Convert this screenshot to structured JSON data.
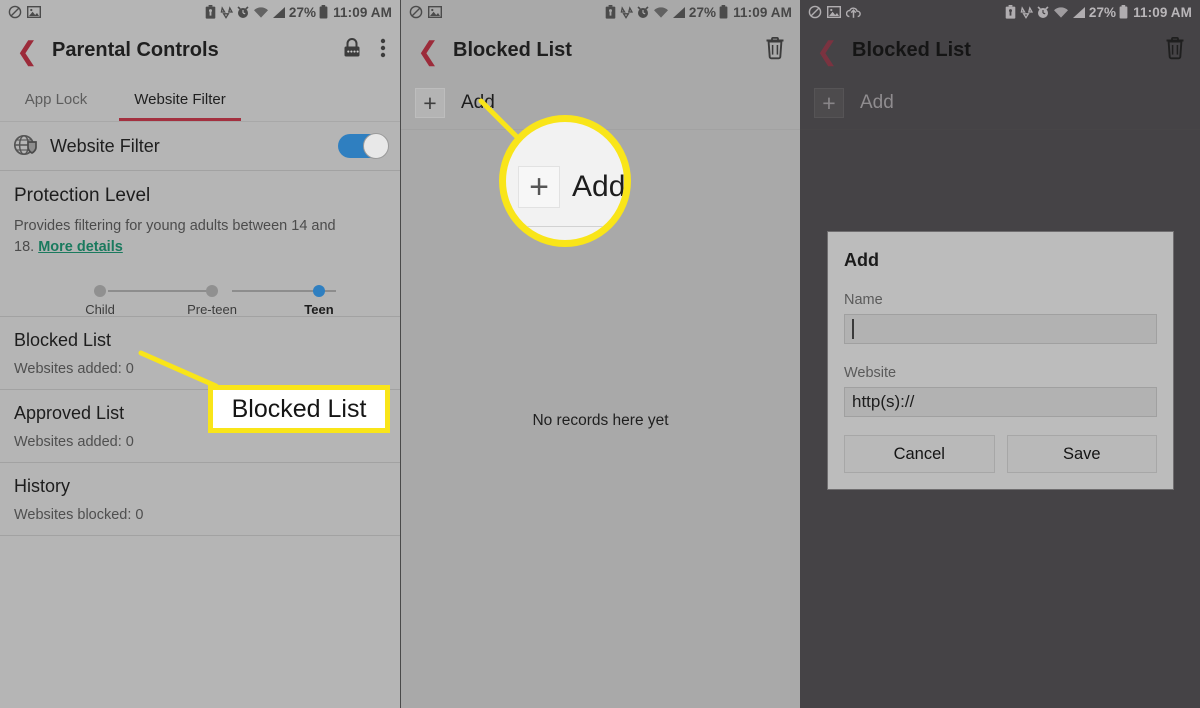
{
  "status_bar": {
    "left_icons": [
      "mute-icon",
      "screenshot-image-icon"
    ],
    "left_icons_panel3": [
      "mute-icon",
      "screenshot-image-icon",
      "upload-cloud-icon"
    ],
    "battery_percent": "27%",
    "time": "11:09 AM",
    "right_icons": [
      "battery-saver-icon",
      "data-saver-icon",
      "alarm-icon",
      "wifi-icon",
      "signal-icon",
      "battery-icon"
    ]
  },
  "panel1": {
    "title": "Parental Controls",
    "back_icon": "back-chevron-icon",
    "lock_icon": "lock-pin-icon",
    "overflow_icon": "more-vertical-icon",
    "tabs": [
      {
        "label": "App Lock",
        "active": false
      },
      {
        "label": "Website Filter",
        "active": true
      }
    ],
    "filter_row": {
      "icon": "globe-shield-icon",
      "label": "Website Filter",
      "toggle_on": true,
      "toggle_color": "#2f7fc0"
    },
    "protection": {
      "title": "Protection Level",
      "description_prefix": "Provides filtering for young adults between 14 and 18. ",
      "link_label": "More details",
      "link_color": "#1a7a5e",
      "stops": [
        {
          "label": "Child",
          "selected": false
        },
        {
          "label": "Pre-teen",
          "selected": false
        },
        {
          "label": "Teen",
          "selected": true
        }
      ]
    },
    "rows": [
      {
        "title": "Blocked List",
        "subtitle": "Websites added: 0"
      },
      {
        "title": "Approved List",
        "subtitle": "Websites added: 0"
      },
      {
        "title": "History",
        "subtitle": "Websites blocked: 0"
      }
    ]
  },
  "panel2": {
    "title": "Blocked List",
    "back_icon": "back-chevron-icon",
    "delete_icon": "trash-icon",
    "add_label": "Add",
    "add_icon": "plus-icon",
    "empty_text": "No records here yet"
  },
  "panel3": {
    "title": "Blocked List",
    "back_icon": "back-chevron-icon",
    "delete_icon": "trash-icon",
    "add_label": "Add",
    "add_icon": "plus-icon",
    "dialog": {
      "title": "Add",
      "name_label": "Name",
      "name_value": "",
      "website_label": "Website",
      "website_value": "http(s)://",
      "cancel_label": "Cancel",
      "save_label": "Save"
    }
  },
  "annotations": {
    "highlight_color": "#f9e519",
    "callout_blocked_list": "Blocked List",
    "magnifier_label": "Add",
    "magnifier_icon": "plus-icon"
  }
}
